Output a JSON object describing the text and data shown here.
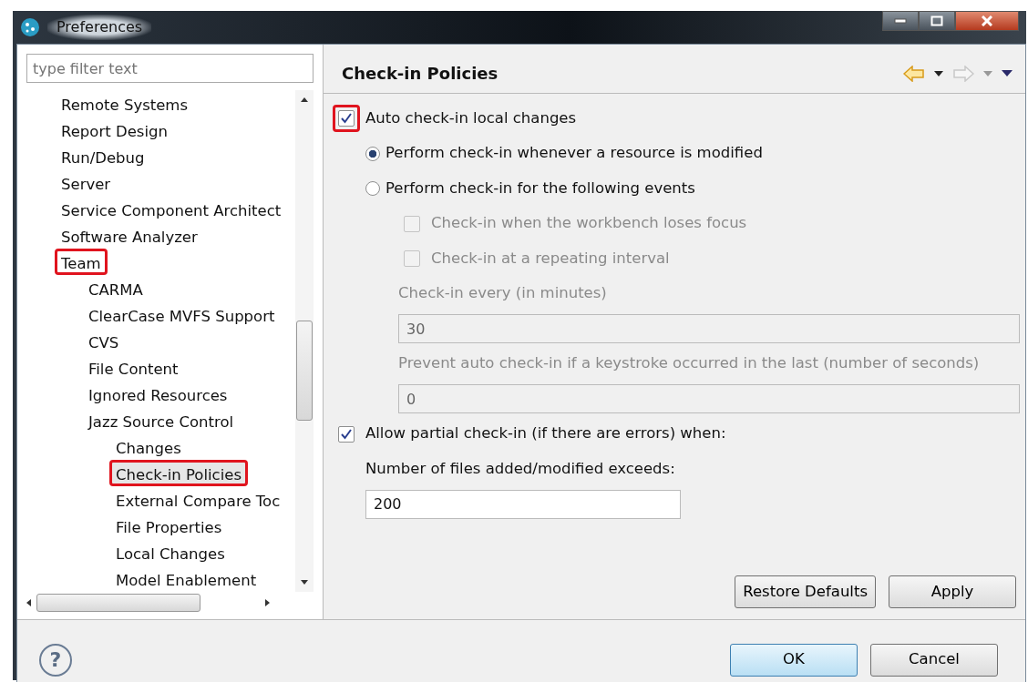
{
  "window": {
    "title": "Preferences"
  },
  "filter": {
    "placeholder": "type filter text"
  },
  "tree": [
    {
      "label": "Remote Systems",
      "selected": false,
      "highlighted": false
    },
    {
      "label": "Report Design",
      "selected": false,
      "highlighted": false
    },
    {
      "label": "Run/Debug",
      "selected": false,
      "highlighted": false
    },
    {
      "label": "Server",
      "selected": false,
      "highlighted": false
    },
    {
      "label": "Service Component Architect",
      "selected": false,
      "highlighted": false
    },
    {
      "label": "Software Analyzer",
      "selected": false,
      "highlighted": false
    },
    {
      "label": "Team",
      "selected": false,
      "highlighted": true,
      "children": [
        {
          "label": "CARMA",
          "selected": false,
          "highlighted": false
        },
        {
          "label": "ClearCase MVFS Support",
          "selected": false,
          "highlighted": false
        },
        {
          "label": "CVS",
          "selected": false,
          "highlighted": false
        },
        {
          "label": "File Content",
          "selected": false,
          "highlighted": false
        },
        {
          "label": "Ignored Resources",
          "selected": false,
          "highlighted": false
        },
        {
          "label": "Jazz Source Control",
          "selected": false,
          "highlighted": false,
          "children": [
            {
              "label": "Changes",
              "selected": false,
              "highlighted": false
            },
            {
              "label": "Check-in Policies",
              "selected": true,
              "highlighted": true
            },
            {
              "label": "External Compare Toc",
              "selected": false,
              "highlighted": false
            },
            {
              "label": "File Properties",
              "selected": false,
              "highlighted": false
            },
            {
              "label": "Local Changes",
              "selected": false,
              "highlighted": false
            },
            {
              "label": "Model Enablement",
              "selected": false,
              "highlighted": false
            }
          ]
        }
      ]
    }
  ],
  "page": {
    "title": "Check-in Policies",
    "options": [
      {
        "kind": "checkbox",
        "label": "Auto check-in local changes",
        "checked": true,
        "disabled": false,
        "highlighted": true,
        "children": [
          {
            "kind": "radio",
            "label": "Perform check-in whenever a resource is modified",
            "selected": true,
            "disabled": false
          },
          {
            "kind": "radio",
            "label": "Perform check-in for the following events",
            "selected": false,
            "disabled": false,
            "children": [
              {
                "kind": "checkbox",
                "label": "Check-in when the workbench loses focus",
                "checked": false,
                "disabled": true,
                "highlighted": false
              },
              {
                "kind": "checkbox",
                "label": "Check-in at a repeating interval",
                "checked": false,
                "disabled": true,
                "highlighted": false
              },
              {
                "kind": "label",
                "label": "Check-in every (in minutes)",
                "disabled": true
              },
              {
                "kind": "field",
                "value": "30",
                "disabled": true,
                "wide": true
              },
              {
                "kind": "label",
                "label": "Prevent auto check-in if a keystroke occurred in the last (number of seconds)",
                "disabled": true
              },
              {
                "kind": "field",
                "value": "0",
                "disabled": true,
                "wide": true
              }
            ]
          }
        ]
      },
      {
        "kind": "checkbox",
        "label": "Allow partial check-in (if there are errors) when:",
        "checked": true,
        "disabled": false,
        "highlighted": false,
        "children": [
          {
            "kind": "label",
            "label": "Number of files added/modified exceeds:",
            "disabled": false
          },
          {
            "kind": "field",
            "value": "200",
            "disabled": false,
            "wide": false
          }
        ]
      }
    ],
    "buttons": [
      "Restore Defaults",
      "Apply"
    ]
  },
  "help": {
    "label": "?"
  },
  "footer_buttons": [
    {
      "label": "OK",
      "default": true
    },
    {
      "label": "Cancel",
      "default": false
    }
  ]
}
